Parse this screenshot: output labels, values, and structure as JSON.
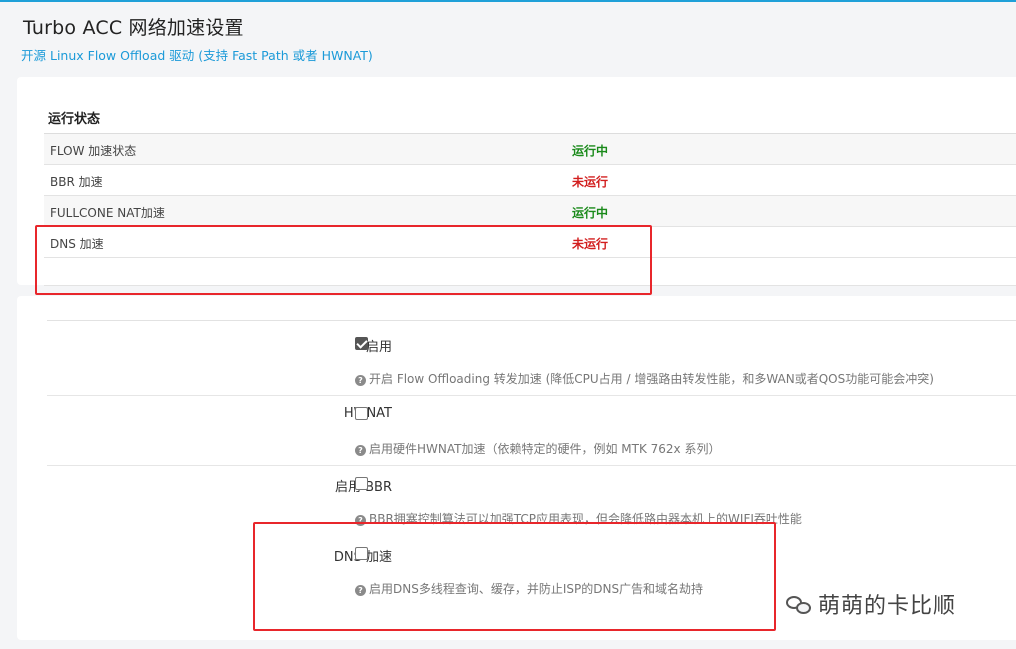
{
  "header": {
    "title": "Turbo ACC 网络加速设置",
    "subtitle": "开源 Linux Flow Offload 驱动 (支持 Fast Path 或者 HWNAT)"
  },
  "status": {
    "section_title": "运行状态",
    "rows": [
      {
        "name": "FLOW 加速状态",
        "value": "运行中",
        "state": "running"
      },
      {
        "name": "BBR 加速",
        "value": "未运行",
        "state": "stopped"
      },
      {
        "name": "FULLCONE NAT加速",
        "value": "运行中",
        "state": "running"
      },
      {
        "name": "DNS 加速",
        "value": "未运行",
        "state": "stopped"
      }
    ]
  },
  "settings": [
    {
      "label": "启用",
      "checked": true,
      "help": "开启 Flow Offloading 转发加速 (降低CPU占用 / 增强路由转发性能，和多WAN或者QOS功能可能会冲突)"
    },
    {
      "label": "HWNAT",
      "checked": false,
      "help": "启用硬件HWNAT加速（依赖特定的硬件，例如 MTK 762x 系列）"
    },
    {
      "label": "启用 BBR",
      "checked": false,
      "help": "BBR拥塞控制算法可以加强TCP应用表现，但会降低路由器本机上的WIFI吞吐性能"
    },
    {
      "label": "DNS 加速",
      "checked": false,
      "help": "启用DNS多线程查询、缓存，并防止ISP的DNS广告和域名劫持"
    }
  ],
  "watermark": {
    "text": "萌萌的卡比顺",
    "icon": "wechat-icon"
  },
  "colors": {
    "accent": "#1b9ad8",
    "running": "#1a8a1a",
    "stopped": "#d21e1e",
    "highlight": "#e8262b"
  }
}
